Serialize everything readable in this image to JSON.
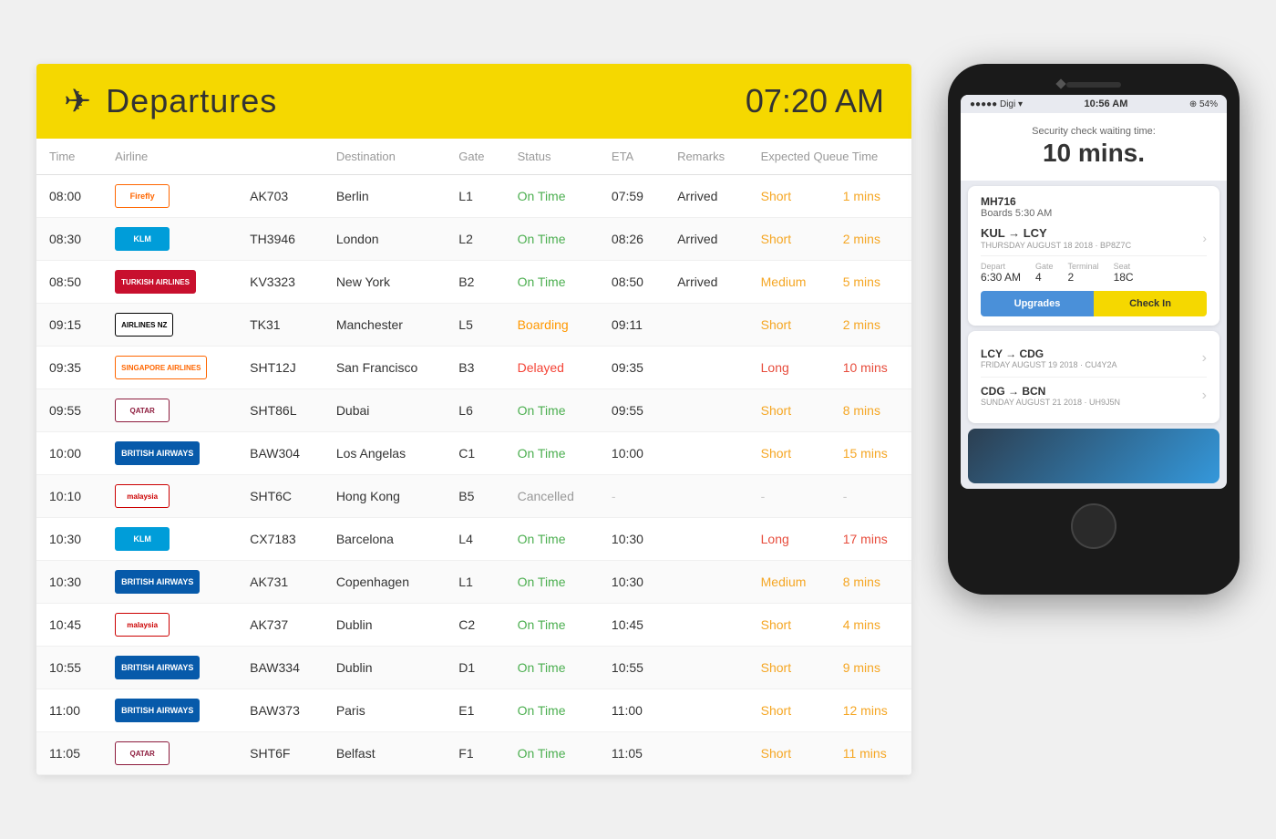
{
  "board": {
    "title": "Departures",
    "time": "07:20 AM",
    "columns": [
      "Time",
      "Airline",
      "",
      "Destination",
      "Gate",
      "Status",
      "ETA",
      "Remarks",
      "Expected Queue Time"
    ],
    "flights": [
      {
        "time": "08:00",
        "airline_code": "Firefly",
        "airline_class": "airline-firefly",
        "flight": "AK703",
        "destination": "Berlin",
        "gate": "L1",
        "status": "On Time",
        "status_class": "status-ontime",
        "eta": "07:59",
        "remarks": "Arrived",
        "queue": "Short",
        "queue_class": "queue-short",
        "mins": "1 mins",
        "mins_class": "queue-mins-orange"
      },
      {
        "time": "08:30",
        "airline_code": "KLM",
        "airline_class": "airline-klm",
        "flight": "TH3946",
        "destination": "London",
        "gate": "L2",
        "status": "On Time",
        "status_class": "status-ontime",
        "eta": "08:26",
        "remarks": "Arrived",
        "queue": "Short",
        "queue_class": "queue-short",
        "mins": "2 mins",
        "mins_class": "queue-mins-orange"
      },
      {
        "time": "08:50",
        "airline_code": "TURKISH AIRLINES",
        "airline_class": "airline-turkish",
        "flight": "KV3323",
        "destination": "New York",
        "gate": "B2",
        "status": "On Time",
        "status_class": "status-ontime",
        "eta": "08:50",
        "remarks": "Arrived",
        "queue": "Medium",
        "queue_class": "queue-medium",
        "mins": "5 mins",
        "mins_class": "queue-mins-orange"
      },
      {
        "time": "09:15",
        "airline_code": "AIRLINES NZ",
        "airline_class": "airline-airnz",
        "flight": "TK31",
        "destination": "Manchester",
        "gate": "L5",
        "status": "Boarding",
        "status_class": "status-boarding",
        "eta": "09:11",
        "remarks": "",
        "queue": "Short",
        "queue_class": "queue-short",
        "mins": "2 mins",
        "mins_class": "queue-mins-orange"
      },
      {
        "time": "09:35",
        "airline_code": "SINGAPORE AIRLINES",
        "airline_class": "airline-singapore",
        "flight": "SHT12J",
        "destination": "San Francisco",
        "gate": "B3",
        "status": "Delayed",
        "status_class": "status-delayed",
        "eta": "09:35",
        "remarks": "",
        "queue": "Long",
        "queue_class": "queue-long",
        "mins": "10 mins",
        "mins_class": "queue-mins"
      },
      {
        "time": "09:55",
        "airline_code": "QATAR",
        "airline_class": "airline-qatar",
        "flight": "SHT86L",
        "destination": "Dubai",
        "gate": "L6",
        "status": "On Time",
        "status_class": "status-ontime",
        "eta": "09:55",
        "remarks": "",
        "queue": "Short",
        "queue_class": "queue-short",
        "mins": "8 mins",
        "mins_class": "queue-mins-orange"
      },
      {
        "time": "10:00",
        "airline_code": "BRITISH AIRWAYS",
        "airline_class": "airline-ba",
        "flight": "BAW304",
        "destination": "Los Angelas",
        "gate": "C1",
        "status": "On Time",
        "status_class": "status-ontime",
        "eta": "10:00",
        "remarks": "",
        "queue": "Short",
        "queue_class": "queue-short",
        "mins": "15 mins",
        "mins_class": "queue-mins-orange"
      },
      {
        "time": "10:10",
        "airline_code": "malaysia",
        "airline_class": "airline-malaysia",
        "flight": "SHT6C",
        "destination": "Hong Kong",
        "gate": "B5",
        "status": "Cancelled",
        "status_class": "status-cancelled",
        "eta": "-",
        "remarks": "",
        "queue": "-",
        "queue_class": "dash",
        "mins": "-",
        "mins_class": "dash"
      },
      {
        "time": "10:30",
        "airline_code": "KLM",
        "airline_class": "airline-klm",
        "flight": "CX7183",
        "destination": "Barcelona",
        "gate": "L4",
        "status": "On Time",
        "status_class": "status-ontime",
        "eta": "10:30",
        "remarks": "",
        "queue": "Long",
        "queue_class": "queue-long",
        "mins": "17 mins",
        "mins_class": "queue-mins"
      },
      {
        "time": "10:30",
        "airline_code": "BRITISH AIRWAYS",
        "airline_class": "airline-ba",
        "flight": "AK731",
        "destination": "Copenhagen",
        "gate": "L1",
        "status": "On Time",
        "status_class": "status-ontime",
        "eta": "10:30",
        "remarks": "",
        "queue": "Medium",
        "queue_class": "queue-medium",
        "mins": "8 mins",
        "mins_class": "queue-mins-orange"
      },
      {
        "time": "10:45",
        "airline_code": "malaysia",
        "airline_class": "airline-malaysia",
        "flight": "AK737",
        "destination": "Dublin",
        "gate": "C2",
        "status": "On Time",
        "status_class": "status-ontime",
        "eta": "10:45",
        "remarks": "",
        "queue": "Short",
        "queue_class": "queue-short",
        "mins": "4 mins",
        "mins_class": "queue-mins-orange"
      },
      {
        "time": "10:55",
        "airline_code": "BRITISH AIRWAYS",
        "airline_class": "airline-ba",
        "flight": "BAW334",
        "destination": "Dublin",
        "gate": "D1",
        "status": "On Time",
        "status_class": "status-ontime",
        "eta": "10:55",
        "remarks": "",
        "queue": "Short",
        "queue_class": "queue-short",
        "mins": "9 mins",
        "mins_class": "queue-mins-orange"
      },
      {
        "time": "11:00",
        "airline_code": "BRITISH AIRWAYS",
        "airline_class": "airline-ba",
        "flight": "BAW373",
        "destination": "Paris",
        "gate": "E1",
        "status": "On Time",
        "status_class": "status-ontime",
        "eta": "11:00",
        "remarks": "",
        "queue": "Short",
        "queue_class": "queue-short",
        "mins": "12 mins",
        "mins_class": "queue-mins-orange"
      },
      {
        "time": "11:05",
        "airline_code": "QATAR",
        "airline_class": "airline-qatar",
        "flight": "SHT6F",
        "destination": "Belfast",
        "gate": "F1",
        "status": "On Time",
        "status_class": "status-ontime",
        "eta": "11:05",
        "remarks": "",
        "queue": "Short",
        "queue_class": "queue-short",
        "mins": "11 mins",
        "mins_class": "queue-mins-orange"
      }
    ]
  },
  "phone": {
    "signal": "●●●●● Digi ▾",
    "time": "10:56 AM",
    "battery": "⊕ 54%",
    "security_label": "Security check waiting time:",
    "security_time": "10 mins.",
    "flight_number": "MH716",
    "boards": "Boards 5:30 AM",
    "route1": "KUL → LCY",
    "route1_sub": "THURSDAY AUGUST 18 2018 · BP8Z7C",
    "depart_label": "Depart",
    "depart_val": "6:30 AM",
    "gate_label": "Gate",
    "gate_val": "4",
    "terminal_label": "Terminal",
    "terminal_val": "2",
    "seat_label": "Seat",
    "seat_val": "18C",
    "btn_upgrades": "Upgrades",
    "btn_checkin": "Check In",
    "route2": "LCY → CDG",
    "route2_sub": "FRIDAY AUGUST 19 2018 · CU4Y2A",
    "route3": "CDG → BCN",
    "route3_sub": "SUNDAY AUGUST 21 2018 · UH9J5N"
  }
}
